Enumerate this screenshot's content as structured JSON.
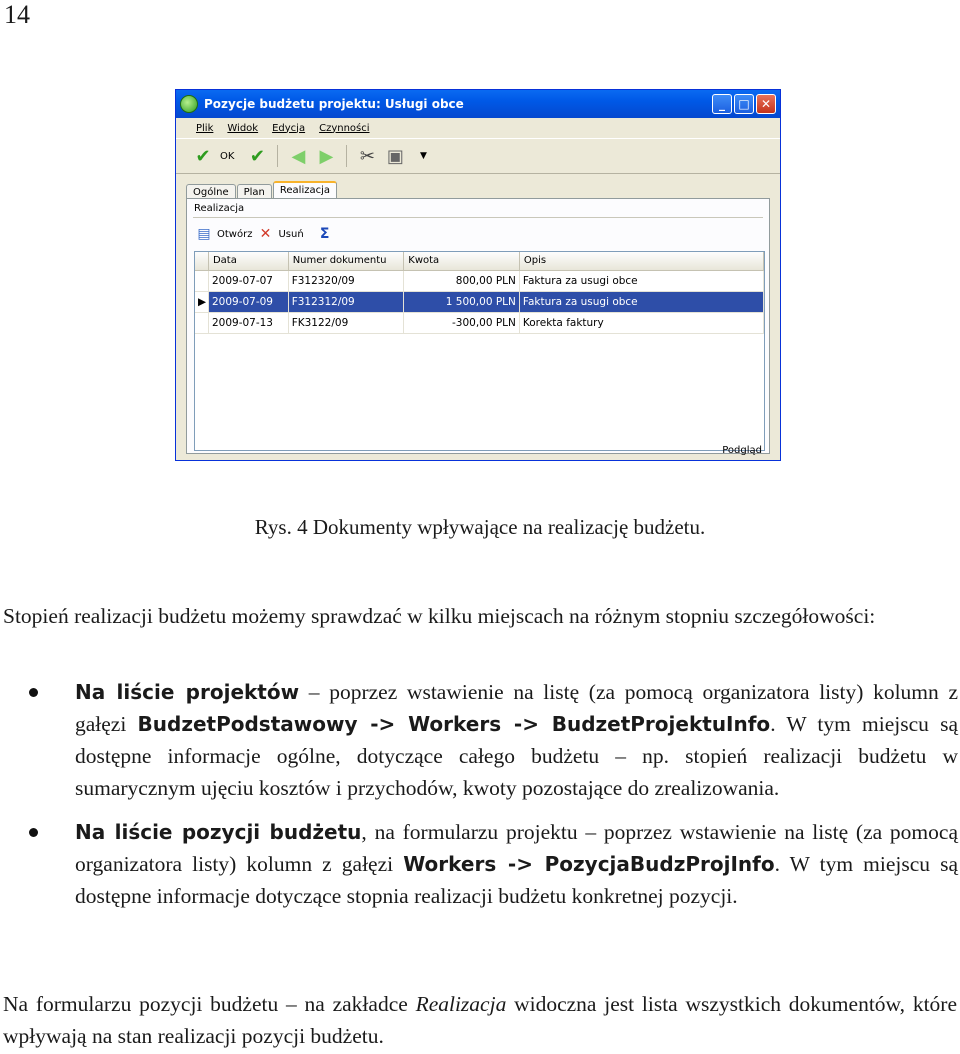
{
  "page_number": "14",
  "window": {
    "title": "Pozycje budżetu projektu: Usługi obce",
    "menu": [
      "Plik",
      "Widok",
      "Edycja",
      "Czynności"
    ],
    "toolbar_ok": "OK",
    "tabs": [
      "Ogólne",
      "Plan",
      "Realizacja"
    ],
    "group_label": "Realizacja",
    "sub_open": "Otwórz",
    "sub_delete": "Usuń",
    "columns": [
      "Data",
      "Numer dokumentu",
      "Kwota",
      "Opis"
    ],
    "rows": [
      {
        "date": "2009-07-07",
        "number": "F312320/09",
        "amount": "800,00 PLN",
        "desc": "Faktura za usugi obce"
      },
      {
        "date": "2009-07-09",
        "number": "F312312/09",
        "amount": "1 500,00 PLN",
        "desc": "Faktura za usugi obce"
      },
      {
        "date": "2009-07-13",
        "number": "FK3122/09",
        "amount": "-300,00 PLN",
        "desc": "Korekta faktury"
      }
    ],
    "status": "Podgląd"
  },
  "caption": "Rys.  4 Dokumenty wpływające na realizację budżetu.",
  "intro": "Stopień realizacji budżetu możemy sprawdzać w kilku miejscach na różnym stopniu szczegółowości:",
  "bullet1": {
    "bold1": "Na liście projektów",
    "text1": " – poprzez wstawienie na listę (za pomocą organizatora listy) kolumn z gałęzi ",
    "bold2": "BudzetPodstawowy -> Workers -> BudzetProjektuInfo",
    "text2": ". W tym miejscu są dostępne informacje ogólne, dotyczące całego budżetu – np. stopień realizacji budżetu w sumarycznym ujęciu kosztów i przychodów, kwoty pozostające do zrealizowania."
  },
  "bullet2": {
    "bold1": "Na liście pozycji budżetu",
    "text1": ", na formularzu projektu – poprzez wstawienie na listę (za pomocą organizatora listy) kolumn z gałęzi ",
    "bold2": "Workers -> PozycjaBudzProjInfo",
    "text2": ". W tym miejscu są dostępne informacje dotyczące stopnia realizacji budżetu konkretnej pozycji."
  },
  "closing": {
    "text1": "Na formularzu pozycji budżetu – na zakładce ",
    "italic": "Realizacja",
    "text2": " widoczna jest lista wszystkich dokumentów, które wpływają na stan realizacji pozycji budżetu."
  }
}
